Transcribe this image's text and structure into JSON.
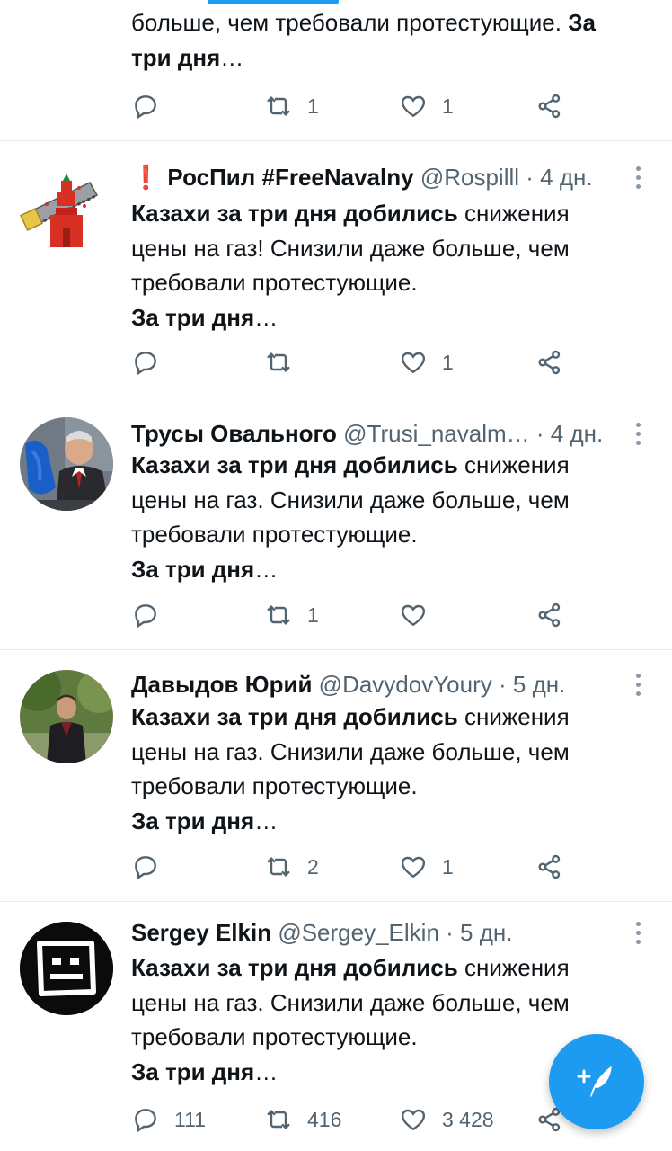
{
  "colors": {
    "accent": "#1d9bf0",
    "text": "#0f1419",
    "muted": "#536471",
    "warn": "#e0245e"
  },
  "tweet0": {
    "line1_prefix": "больше, чем требовали протестующие. ",
    "line1_bold": "За",
    "line2_bold": "три дня",
    "ellipsis": "…",
    "retweets": "1",
    "likes": "1"
  },
  "tweets": [
    {
      "warn_icon": "❗",
      "name": "РосПил #FreeNavalny",
      "handle": "@Rospilll",
      "time": "· 4 дн.",
      "avatar": "kremlin-saw-logo",
      "text_bold": "Казахи за три дня добились",
      "text_rest1": " снижения",
      "text_line2": "цены на газ! Снизили даже больше, чем",
      "text_line3": "требовали протестующие.",
      "text_last_bold": "За три дня",
      "ellipsis": "…",
      "replies": "",
      "retweets": "",
      "likes": "1"
    },
    {
      "name": "Трусы Овального",
      "handle": "@Trusi_navalm…",
      "time": "· 4 дн.",
      "avatar": "man-holding-blue-cloth-photo",
      "text_bold": "Казахи за три дня добились",
      "text_rest1": " снижения",
      "text_line2": "цены на газ. Снизили даже больше, чем",
      "text_line3": "требовали протестующие.",
      "text_last_bold": "За три дня",
      "ellipsis": "…",
      "replies": "",
      "retweets": "1",
      "likes": ""
    },
    {
      "name": "Давыдов Юрий",
      "handle": "@DavydovYoury",
      "time": "· 5 дн.",
      "avatar": "man-outdoors-photo",
      "text_bold": "Казахи за три дня добились",
      "text_rest1": " снижения",
      "text_line2": "цены на газ. Снизили даже больше, чем",
      "text_line3": "требовали протестующие.",
      "text_last_bold": "За три дня",
      "ellipsis": "…",
      "replies": "",
      "retweets": "2",
      "likes": "1"
    },
    {
      "name": "Sergey Elkin",
      "handle": "@Sergey_Elkin",
      "time": "· 5 дн.",
      "avatar": "black-circle-square-face-logo",
      "text_bold": "Казахи за три дня добились",
      "text_rest1": " снижения",
      "text_line2": "цены на газ. Снизили даже больше, чем",
      "text_line3": "требовали протестующие.",
      "text_last_bold": "За три дня",
      "ellipsis": "…",
      "replies": "111",
      "retweets": "416",
      "likes": "3 428"
    }
  ],
  "icons": {
    "reply": "reply-icon",
    "retweet": "retweet-icon",
    "like": "heart-icon",
    "share": "share-icon",
    "more": "more-vertical-icon",
    "compose": "compose-tweet-icon"
  }
}
